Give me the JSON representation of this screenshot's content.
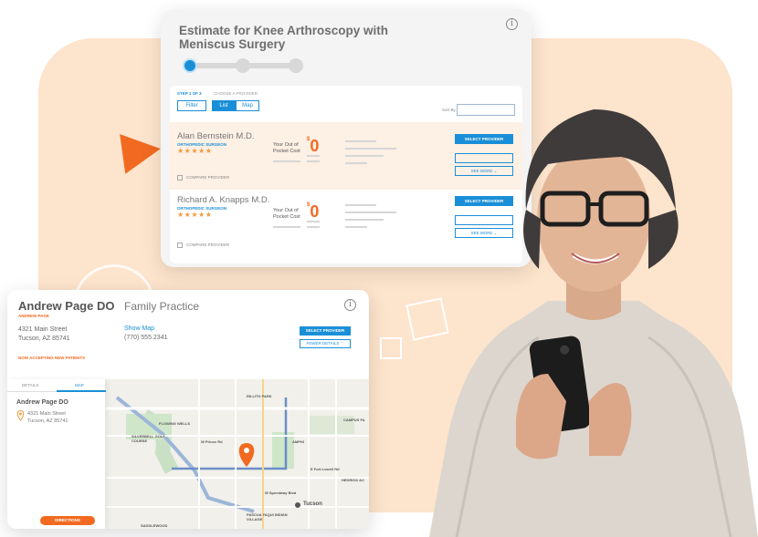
{
  "estimate": {
    "title": "Estimate for Knee Arthroscopy with Meniscus Surgery",
    "step_label": "STEP 1 OF 3",
    "step_name": "CHOOSE A PROVIDER",
    "filter_label": "Filter",
    "list_label": "List",
    "map_label": "Map",
    "sort_label": "Sort By",
    "providers": [
      {
        "name": "Alan Bernstein M.D.",
        "specialty": "ORTHOPEDIC SURGEON",
        "stars": "★★★★★",
        "oop_label": "Your Out of Pocket Cost",
        "oop_symbol": "$",
        "oop_value": "0",
        "select_label": "SELECT PROVIDER",
        "see_more_label": "SEE MORE",
        "compare_label": "COMPARE PROVIDER"
      },
      {
        "name": "Richard A. Knapps M.D.",
        "specialty": "ORTHOPEDIC SURGEON",
        "stars": "★★★★★",
        "oop_label": "Your Out of Pocket Cost",
        "oop_symbol": "$",
        "oop_value": "0",
        "select_label": "SELECT PROVIDER",
        "see_more_label": "SEE MORE",
        "compare_label": "COMPARE PROVIDER"
      }
    ]
  },
  "provider": {
    "name": "Andrew Page DO",
    "role": "Family Practice",
    "subtitle": "ANDREW PAGE",
    "address": "4321 Main Street\nTucson, AZ 85741",
    "show_map": "Show Map",
    "phone": "(770) 555 2341",
    "accepting": "NOW ACCEPTING NEW PATIENTS",
    "select_label": "SELECT PROVIDER",
    "fewer_label": "FEWER DETAILS",
    "tab_details": "DETAILS",
    "tab_map": "MAP",
    "map_name": "Andrew Page DO",
    "map_address": "4321 Main Street\nTucson, AZ 85741",
    "directions_label": "DIRECTIONS",
    "map_labels": [
      "RILLITO PARK",
      "CAMPUS FA",
      "FLOWING WELLS",
      "SILVERBELL GOLF COURSE",
      "W Prince Rd",
      "AMPHI",
      "E Fort Lowell Rd",
      "HEDRICK AC",
      "Tucson",
      "W Speedway Blvd",
      "PASCUA YAQUI INDIAN VILLAGE",
      "SADDLEWOOD"
    ]
  },
  "colors": {
    "accent_orange": "#f26a21",
    "accent_blue": "#1a8fd8",
    "bg_peach": "#fde4cc"
  }
}
